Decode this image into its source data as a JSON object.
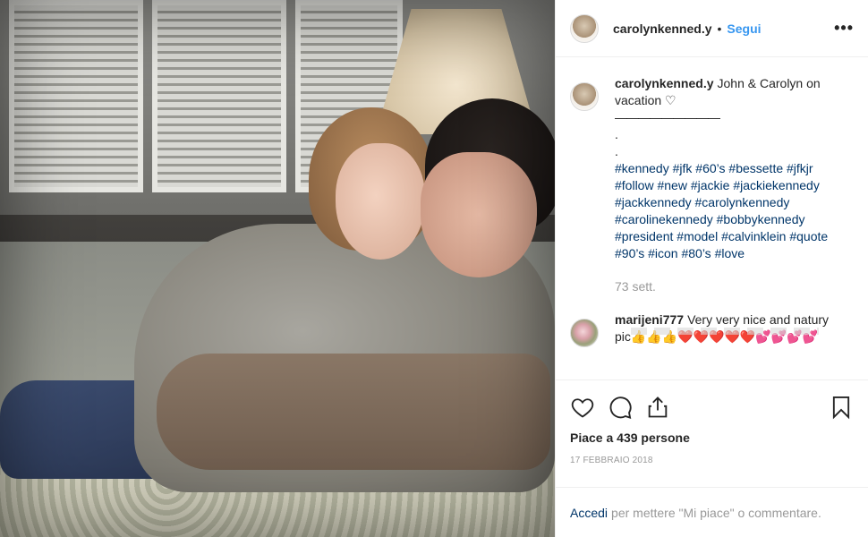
{
  "post": {
    "username": "carolynkenned.y",
    "dot": "•",
    "follow_label": "Segui",
    "more_label": "•••"
  },
  "caption": {
    "username": "carolynkenned.y",
    "text": "John & Carolyn on vacation ♡",
    "divider": "—————————",
    "dot1": ".",
    "dot2": ".",
    "hashtags": [
      "#kennedy",
      "#jfk",
      "#60’s",
      "#bessette",
      "#jfkjr",
      "#follow",
      "#new",
      "#jackie",
      "#jackiekennedy",
      "#jackkennedy",
      "#carolynkennedy",
      "#carolinekennedy",
      "#bobbykennedy",
      "#president",
      "#model",
      "#calvinklein",
      "#quote",
      "#90’s",
      "#icon",
      "#80’s",
      "#love"
    ],
    "time": "73 sett."
  },
  "comment": {
    "username": "marijeni777",
    "text": "Very very nice and natury pic👍👍👍❤️❤️❤️❤️❤️💕💕💕💕"
  },
  "actions": {
    "like_icon": "heart-icon",
    "comment_icon": "comment-icon",
    "share_icon": "share-icon",
    "save_icon": "bookmark-icon",
    "likes_text": "Piace a 439 persone",
    "date_text": "17 FEBBRAIO 2018"
  },
  "login": {
    "link_label": "Accedi",
    "text": "per mettere \"Mi piace\" o commentare."
  },
  "colors": {
    "link_blue": "#3897f0",
    "hashtag_blue": "#003569",
    "muted": "#999999"
  }
}
